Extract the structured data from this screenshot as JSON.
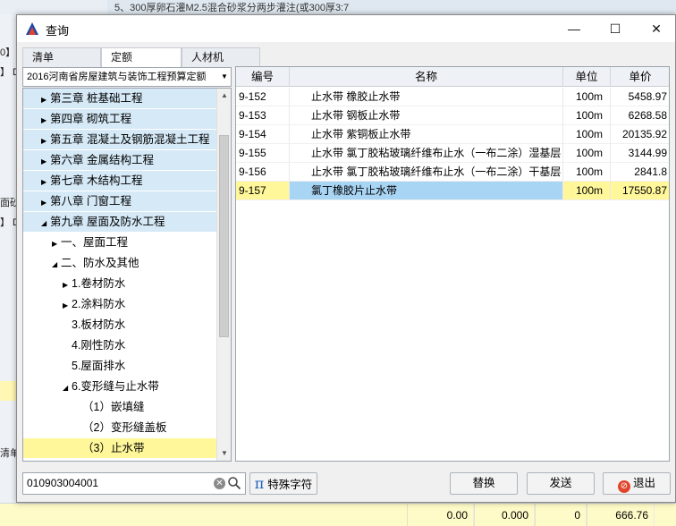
{
  "background": {
    "top_text": "5、300厚卵石灌M2.5混合砂浆分两步灌注(或300厚3:7",
    "left_fragments": [
      "0】",
      "】 D",
      "面砂",
      "】 D",
      "清单"
    ],
    "bottom_values": [
      "0.00",
      "0.000",
      "0",
      "666.76"
    ]
  },
  "dialog": {
    "title": "查询",
    "controls": {
      "minimize": "—",
      "maximize": "☐",
      "close": "✕"
    },
    "tabs": [
      "清单",
      "定额",
      "人材机"
    ],
    "active_tab": "定额",
    "dropdown_value": "2016河南省房屋建筑与装饰工程预算定额",
    "tree": [
      {
        "label": "第三章 桩基础工程",
        "indent": 0,
        "expander": "▶",
        "style": "blue"
      },
      {
        "label": "第四章 砌筑工程",
        "indent": 0,
        "expander": "▶",
        "style": "blue"
      },
      {
        "label": "第五章 混凝土及钢筋混凝土工程",
        "indent": 0,
        "expander": "▶",
        "style": "blue"
      },
      {
        "label": "第六章 金属结构工程",
        "indent": 0,
        "expander": "▶",
        "style": "blue"
      },
      {
        "label": "第七章 木结构工程",
        "indent": 0,
        "expander": "▶",
        "style": "blue"
      },
      {
        "label": "第八章 门窗工程",
        "indent": 0,
        "expander": "▶",
        "style": "blue"
      },
      {
        "label": "第九章 屋面及防水工程",
        "indent": 0,
        "expander": "◢",
        "style": "blue"
      },
      {
        "label": "一、屋面工程",
        "indent": 1,
        "expander": "▶",
        "style": ""
      },
      {
        "label": "二、防水及其他",
        "indent": 1,
        "expander": "◢",
        "style": ""
      },
      {
        "label": "1.卷材防水",
        "indent": 2,
        "expander": "▶",
        "style": ""
      },
      {
        "label": "2.涂料防水",
        "indent": 2,
        "expander": "▶",
        "style": ""
      },
      {
        "label": "3.板材防水",
        "indent": 2,
        "expander": "",
        "style": ""
      },
      {
        "label": "4.刚性防水",
        "indent": 2,
        "expander": "",
        "style": ""
      },
      {
        "label": "5.屋面排水",
        "indent": 2,
        "expander": "",
        "style": ""
      },
      {
        "label": "6.变形缝与止水带",
        "indent": 2,
        "expander": "◢",
        "style": ""
      },
      {
        "label": "（1）嵌填缝",
        "indent": 3,
        "expander": "",
        "style": ""
      },
      {
        "label": "（2）变形缝盖板",
        "indent": 3,
        "expander": "",
        "style": ""
      },
      {
        "label": "（3）止水带",
        "indent": 3,
        "expander": "",
        "style": "sel"
      }
    ],
    "grid": {
      "headers": {
        "code": "编号",
        "name": "名称",
        "unit": "单位",
        "price": "单价"
      },
      "rows": [
        {
          "code": "9-152",
          "name": "止水带 橡胶止水带",
          "unit": "100m",
          "price": "5458.97",
          "selected": false
        },
        {
          "code": "9-153",
          "name": "止水带 钢板止水带",
          "unit": "100m",
          "price": "6268.58",
          "selected": false
        },
        {
          "code": "9-154",
          "name": "止水带 紫铜板止水带",
          "unit": "100m",
          "price": "20135.92",
          "selected": false
        },
        {
          "code": "9-155",
          "name": "止水带 氯丁胶粘玻璃纤维布止水（一布二涂）湿基层",
          "unit": "100m",
          "price": "3144.99",
          "selected": false
        },
        {
          "code": "9-156",
          "name": "止水带 氯丁胶粘玻璃纤维布止水（一布二涂）干基层",
          "unit": "100m",
          "price": "2841.8",
          "selected": false
        },
        {
          "code": "9-157",
          "name": "氯丁橡胶片止水带",
          "unit": "100m",
          "price": "17550.87",
          "selected": true
        }
      ]
    },
    "search_value": "010903004001",
    "buttons": {
      "special": "特殊字符",
      "replace": "替换",
      "send": "发送",
      "exit": "退出"
    },
    "colors": {
      "selection_yellow": "#fff79a",
      "tree_blue": "#d5e9f7",
      "selected_cell_blue": "#a9d5f5"
    }
  }
}
